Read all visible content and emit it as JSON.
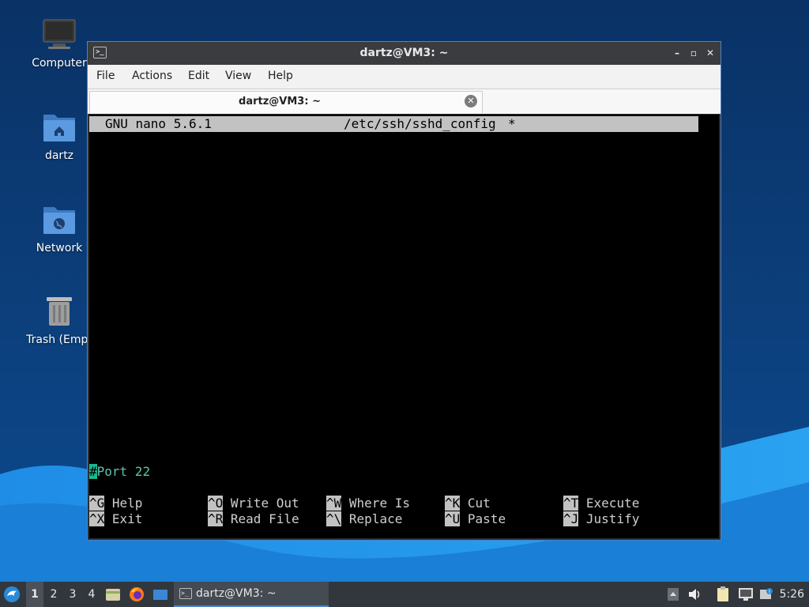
{
  "desktop": {
    "icons": [
      {
        "label": "Computer",
        "icon": "computer-icon"
      },
      {
        "label": "dartz",
        "icon": "home-folder-icon"
      },
      {
        "label": "Network",
        "icon": "network-folder-icon"
      },
      {
        "label": "Trash (Empt",
        "icon": "trash-icon"
      }
    ]
  },
  "window": {
    "title": "dartz@VM3: ~",
    "app_icon_glyph": ">_",
    "controls": {
      "minimize": "–",
      "maximize": "▫",
      "close": "✕"
    },
    "menu": [
      "File",
      "Actions",
      "Edit",
      "View",
      "Help"
    ],
    "tab": {
      "label": "dartz@VM3: ~",
      "close_glyph": "✕"
    }
  },
  "nano": {
    "version": "GNU nano 5.6.1",
    "filename": "/etc/ssh/sshd_config",
    "modified": "*",
    "cursor_char": "#",
    "line_text": "Port 22",
    "shortcuts": [
      [
        {
          "key": "^G",
          "label": "Help"
        },
        {
          "key": "^O",
          "label": "Write Out"
        },
        {
          "key": "^W",
          "label": "Where Is"
        },
        {
          "key": "^K",
          "label": "Cut"
        },
        {
          "key": "^T",
          "label": "Execute"
        }
      ],
      [
        {
          "key": "^X",
          "label": "Exit"
        },
        {
          "key": "^R",
          "label": "Read File"
        },
        {
          "key": "^\\",
          "label": "Replace"
        },
        {
          "key": "^U",
          "label": "Paste"
        },
        {
          "key": "^J",
          "label": "Justify"
        }
      ]
    ]
  },
  "taskbar": {
    "workspaces": [
      "1",
      "2",
      "3",
      "4"
    ],
    "active_workspace": "1",
    "task_label": "dartz@VM3: ~",
    "clock": "5:26"
  },
  "colors": {
    "accent": "#4d83c9",
    "nano_bar": "#c2c2c2",
    "cursor": "#19b890",
    "comment_text": "#5cc7ad"
  }
}
